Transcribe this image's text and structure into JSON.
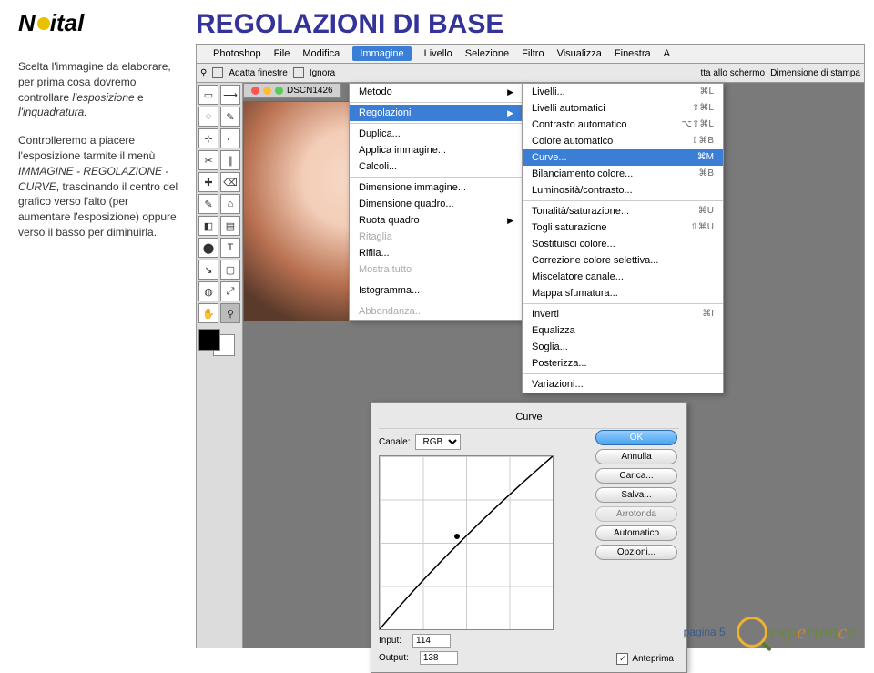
{
  "logo": {
    "part1": "N",
    "part2": "ital"
  },
  "title": "REGOLAZIONI DI BASE",
  "sidebar": {
    "p1_a": "Scelta l'immagine da elaborare, per prima cosa dovremo controllare ",
    "p1_b": "l'esposizione",
    "p1_c": " e ",
    "p1_d": "l'inquadratura.",
    "p2_a": "Controlleremo a piacere l'esposizione tarmite il menù ",
    "p2_b": "IMMAGINE - REGOLAZIONE - CURVE",
    "p2_c": ", trascinando il centro del grafico verso l'alto (per aumentare l'esposizione) oppure verso il basso per diminuirla."
  },
  "menubar": {
    "apple": "",
    "items": [
      "Photoshop",
      "File",
      "Modifica",
      "Immagine",
      "Livello",
      "Selezione",
      "Filtro",
      "Visualizza",
      "Finestra",
      "A"
    ],
    "active_index": 3
  },
  "optbar": {
    "adatta": "Adatta finestre",
    "ignora": "Ignora",
    "atta": "tta allo schermo",
    "dim": "Dimensione di stampa"
  },
  "doc_tab": "DSCN1426",
  "tools": [
    "▭",
    "⟶",
    "◌",
    "✎",
    "⊹",
    "⌐",
    "✂",
    "∥",
    "✚",
    "⌫",
    "✎",
    "⌂",
    "◧",
    "▤",
    "⬤",
    "◓",
    "◐",
    "T",
    "↘",
    "▢",
    "◍",
    "⤢",
    "✋",
    "⚲"
  ],
  "menu1": {
    "metodo": "Metodo",
    "regolazioni": "Regolazioni",
    "duplica": "Duplica...",
    "applica": "Applica immagine...",
    "calcoli": "Calcoli...",
    "dim_img": "Dimensione immagine...",
    "dim_q": "Dimensione quadro...",
    "ruota": "Ruota quadro",
    "ritaglia": "Ritaglia",
    "rifila": "Rifila...",
    "mostra": "Mostra tutto",
    "isto": "Istogramma...",
    "abb": "Abbondanza..."
  },
  "menu2": {
    "livelli": {
      "l": "Livelli...",
      "s": "⌘L"
    },
    "liv_auto": {
      "l": "Livelli automatici",
      "s": "⇧⌘L"
    },
    "contr_auto": {
      "l": "Contrasto automatico",
      "s": "⌥⇧⌘L"
    },
    "col_auto": {
      "l": "Colore automatico",
      "s": "⇧⌘B"
    },
    "curve": {
      "l": "Curve...",
      "s": "⌘M"
    },
    "bil": {
      "l": "Bilanciamento colore...",
      "s": "⌘B"
    },
    "lum": {
      "l": "Luminosità/contrasto...",
      "s": ""
    },
    "ton": {
      "l": "Tonalità/saturazione...",
      "s": "⌘U"
    },
    "togli": {
      "l": "Togli saturazione",
      "s": "⇧⌘U"
    },
    "sost": {
      "l": "Sostituisci colore...",
      "s": ""
    },
    "corr": {
      "l": "Correzione colore selettiva...",
      "s": ""
    },
    "misc": {
      "l": "Miscelatore canale...",
      "s": ""
    },
    "sfum": {
      "l": "Mappa sfumatura...",
      "s": ""
    },
    "inv": {
      "l": "Inverti",
      "s": "⌘I"
    },
    "eq": {
      "l": "Equalizza",
      "s": ""
    },
    "soglia": {
      "l": "Soglia...",
      "s": ""
    },
    "post": {
      "l": "Posterizza...",
      "s": ""
    },
    "var": {
      "l": "Variazioni...",
      "s": ""
    }
  },
  "curves": {
    "title": "Curve",
    "canale": "Canale:",
    "canale_val": "RGB",
    "input_l": "Input:",
    "input_v": "114",
    "output_l": "Output:",
    "output_v": "138",
    "ok": "OK",
    "annulla": "Annulla",
    "carica": "Carica...",
    "salva": "Salva...",
    "arrotonda": "Arrotonda",
    "auto": "Automatico",
    "opzioni": "Opzioni...",
    "anteprima": "Anteprima"
  },
  "footer": {
    "page": "pagina 5",
    "brand": "experience"
  }
}
